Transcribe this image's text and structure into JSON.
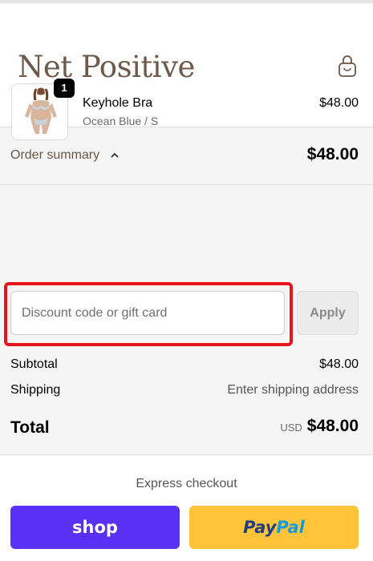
{
  "header": {
    "logo": "Net Positive",
    "cart_icon": "shopping-bag-icon"
  },
  "order_summary": {
    "toggle_label": "Order summary",
    "toggle_icon": "chevron-up-icon",
    "total": "$48.00",
    "items": [
      {
        "name": "Keyhole Bra",
        "variant": "Ocean Blue / S",
        "price": "$48.00",
        "quantity": "1"
      }
    ],
    "discount": {
      "placeholder": "Discount code or gift card",
      "value": "",
      "apply_label": "Apply"
    },
    "subtotal_label": "Subtotal",
    "subtotal_value": "$48.00",
    "shipping_label": "Shipping",
    "shipping_value": "Enter shipping address",
    "total_label": "Total",
    "currency": "USD",
    "total_value": "$48.00"
  },
  "express_checkout": {
    "label": "Express checkout",
    "shop_label": "shop",
    "paypal_label_a": "Pay",
    "paypal_label_b": "Pal"
  },
  "colors": {
    "accent_brown": "#6b5646",
    "highlight_red": "#e8141c",
    "shop_purple": "#5a31f4",
    "paypal_yellow": "#ffc439"
  }
}
